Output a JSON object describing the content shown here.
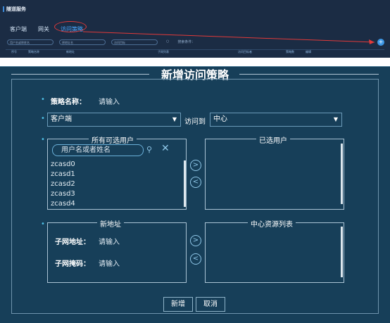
{
  "top_panel": {
    "title": "隧道服务",
    "tabs": [
      "客户端",
      "网关",
      "访问策略"
    ],
    "filters": [
      "用户名或称姓名",
      "原地址名",
      "访问目标"
    ],
    "search_label": "搜索条件：",
    "table_headers": [
      "序号",
      "策略名称",
      "新地址",
      "子网列表",
      "访问目标者",
      "策略数",
      "编辑"
    ],
    "colors": {
      "highlight": "#e23a3a",
      "accent": "#3c97e6"
    }
  },
  "dialog": {
    "title": "新增访问策略",
    "policy_name_label": "策略名称：",
    "policy_name_placeholder": "请输入",
    "source_type": "客户端",
    "access_to_label": "访问到",
    "target_type": "中心",
    "available_users_title": "所有可选用户",
    "user_search_placeholder": "用户名或者姓名",
    "users": [
      "zcasd0",
      "zcasd1",
      "zcasd2",
      "zcasd3",
      "zcasd4"
    ],
    "selected_users_title": "已选用户",
    "new_address_title": "新地址",
    "subnet_address_label": "子网地址：",
    "subnet_address_placeholder": "请输入",
    "subnet_mask_label": "子网掩码：",
    "subnet_mask_placeholder": "请输入",
    "center_resources_title": "中心资源列表",
    "add_button": "新增",
    "cancel_button": "取消"
  }
}
